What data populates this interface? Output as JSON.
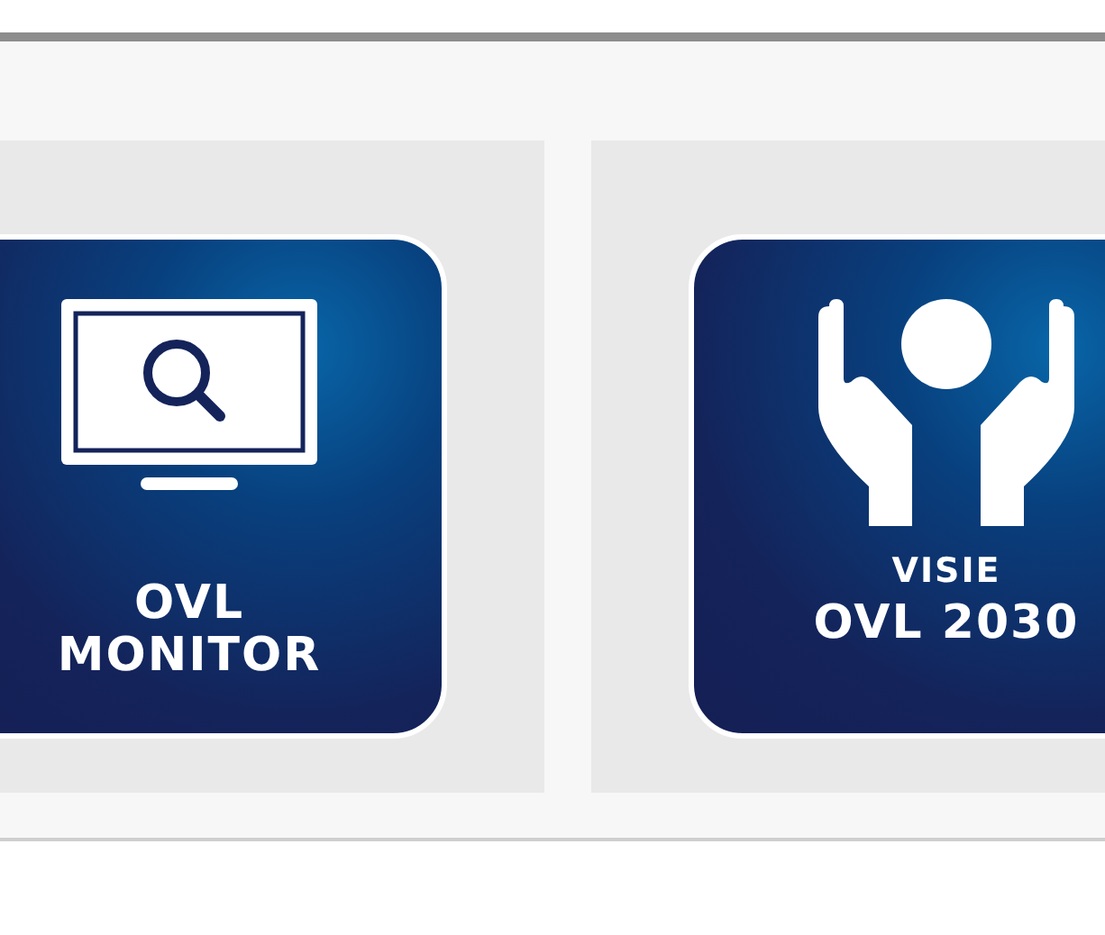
{
  "tiles": [
    {
      "kind": "monitor",
      "title": "OVL\nMONITOR"
    },
    {
      "kind": "hands",
      "caption": "VISIE",
      "title": "OVL 2030"
    }
  ]
}
